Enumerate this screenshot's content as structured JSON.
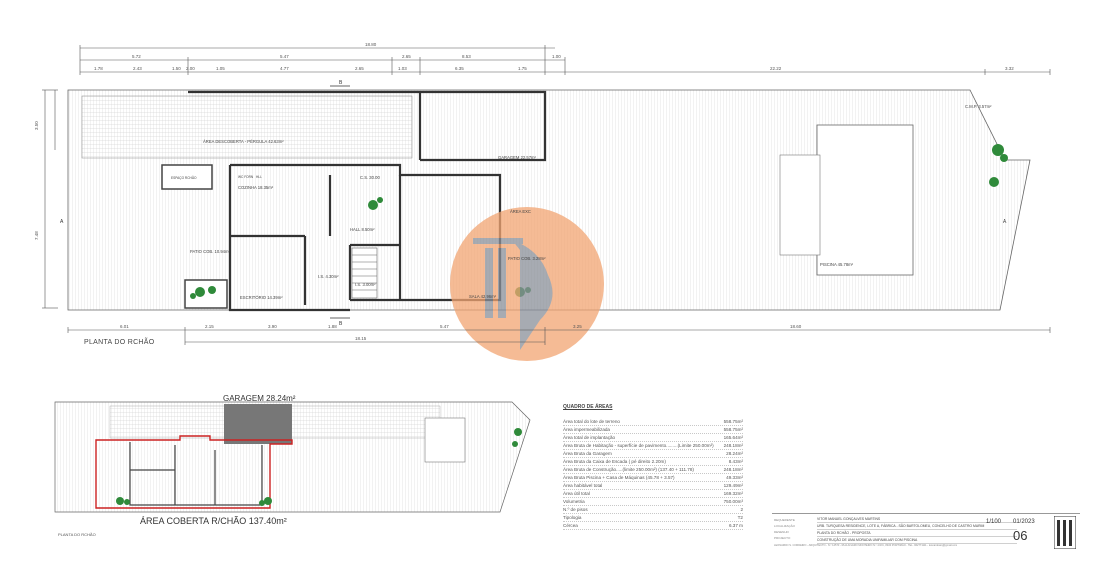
{
  "drawing": {
    "main_plan_label": "PLANTA DO RCHÃO",
    "small_plan_label": "PLANTA DO RCHÃO",
    "area_coberta_label": "ÁREA COBERTA R/CHÃO 137.40m²",
    "garagem_label": "GARAGEM 28.24m²",
    "top_dims_row1": [
      "5.72",
      "5.47",
      "2.65",
      "8.53",
      "1.00"
    ],
    "top_dims_overall": "18.80",
    "top_dims_row2": [
      "1.78",
      "2.43",
      "1.50",
      "2.00",
      "1.05",
      "4.77",
      "2.65",
      "1.03",
      "6.35",
      "1.75",
      "22.22",
      "3.32"
    ],
    "bottom_dims_row1": [
      "6.01",
      "2.15",
      "3.90",
      "1.88",
      "5.47",
      "3.25",
      "18.60"
    ],
    "bottom_dims_overall": "18.15",
    "left_dims": [
      "3.50",
      "7.48"
    ],
    "section_labels": [
      "B",
      "B",
      "A",
      "A"
    ],
    "room_labels": {
      "area_descoberta": "ÁREA DESCOBERTA - PÉRGULA 42.63m²",
      "garagem": "GARAGEM 22.57m²",
      "cozinha": "COZINHA 18.35m²",
      "espaco_rochao": "ESPAÇO RCHÃO",
      "patio_cob1": "PATIO COB. 10.94m²",
      "escritorio": "ESCRITÓRIO 14.39m²",
      "hall": "HALL 8.50m²",
      "is_small": "I.S. 4.30m²",
      "patio_cob2": "PATIO COB. 3.28m²",
      "sala": "SALA 42.96m²",
      "piscina": "PISCINA 45.78m²",
      "cmp": "C.M.P. 3.57m²",
      "cs": "C.S. 30.00",
      "wc": "WC FORN",
      "hall2": "HLL",
      "area_exc": "ÁREA EXC",
      "is_2": "I.S. 3.00m²"
    }
  },
  "quadro_areas": {
    "title": "QUADRO DE ÁREAS",
    "rows": [
      {
        "label": "Área total do lote de terreno",
        "value": "558.75m²"
      },
      {
        "label": "Área impermeabilizada",
        "value": "558.75m²"
      },
      {
        "label": "Área total de implantação",
        "value": "165.64m²"
      },
      {
        "label": "Área Bruta de Habitação - superfície de pavimento.........(Limite 250.00m²)",
        "value": "248.18m²"
      },
      {
        "label": "Área Bruta da Garagem",
        "value": "28.24m²"
      },
      {
        "label": "Área Bruta da Caixa de Escada ( pé direito 2.20m)",
        "value": "8.43m²"
      },
      {
        "label": "Área Bruta de Construção.....(limite 250.00m²) (137.40 + 111.78)",
        "value": "248.18m²"
      },
      {
        "label": "Área Bruta Piscina + Casa de Máquinas (45.78 + 3.57)",
        "value": "49.33m²"
      },
      {
        "label": "Área habitável total",
        "value": "129.49m²"
      },
      {
        "label": "Área útil total",
        "value": "169.32m²"
      },
      {
        "label": "Volumetria",
        "value": "750.00m³"
      },
      {
        "label": "N.º de pisos",
        "value": "2"
      },
      {
        "label": "Tipologia",
        "value": "T2"
      },
      {
        "label": "Cércea",
        "value": "6.37 m"
      }
    ]
  },
  "title_block": {
    "labels": [
      "REQUERENTE",
      "LOCALIZAÇÃO",
      "DESENHO",
      "PROJECTO"
    ],
    "lines": [
      "VITOR MANUEL GONÇALVES MARTINS",
      "URB. TURQUESA RESIDENCE, LOTE A, FÁBRICA - SÃO BARTOLOMEU, CONCELHO DE CASTRO MARIM",
      "PLANTA DO RCHÃO - PROPOSTA",
      "CONSTRUÇÃO DE UMA MORADIA UNIFAMILIAR COM PISCINA"
    ],
    "footer": "LEONARDO S. CORDEIRO - ARQUITECTO - N.º 14573 - RUA ALVARO MONTEIRO N.º 4 R/C, 8400 PORTIMÃO - TEL. 962771111 - leonardoarq@gmail.com",
    "scale": "1/100",
    "date": "01/2023",
    "sheet_number": "06"
  },
  "colors": {
    "line": "#444444",
    "light_line": "#9a9a9a",
    "hatch": "#bdbdbd",
    "red_outline": "#cc2222",
    "plants": "#2f8a3a",
    "watermark_orange": "#f0a070"
  }
}
